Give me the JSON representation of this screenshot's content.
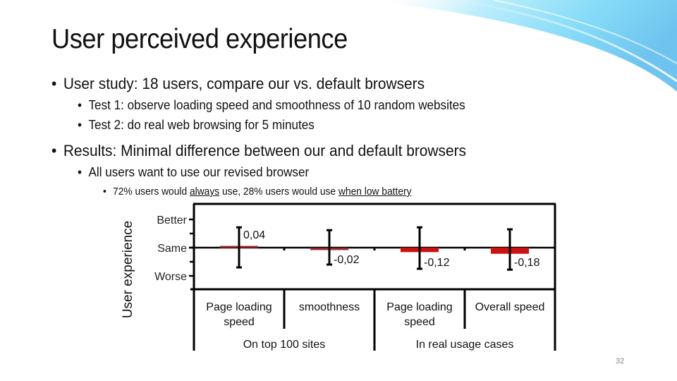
{
  "slide": {
    "title": "User perceived experience",
    "page_number": "32",
    "bullets": {
      "b1": "User study: 18 users, compare our vs. default browsers",
      "b1_sub1": "Test 1: observe loading speed and smoothness of 10 random websites",
      "b1_sub2": "Test 2: do real web browsing for 5 minutes",
      "b2": "Results: Minimal difference between our and default browsers",
      "b2_sub1": "All users want to use our revised browser",
      "b2_sub1_sub": {
        "part1": "72% users would ",
        "always": "always",
        "part2": " use, 28% users would use ",
        "when_low": "when low battery"
      }
    },
    "colors": {
      "bar": "#cc1111",
      "bar_faint": "#8b1a1a",
      "swoosh": "#7fd3f5"
    }
  },
  "chart_data": {
    "type": "bar",
    "title": "",
    "ylabel": "User experience",
    "xlabel": "",
    "y_tick_labels": [
      "Better",
      "Same",
      "Worse"
    ],
    "y_tick_values": [
      1,
      0,
      -1
    ],
    "ylim": [
      -1.5,
      1.5
    ],
    "grid": false,
    "categories": [
      "Page loading speed",
      "smoothness",
      "Page loading speed",
      "Overall speed"
    ],
    "category_lines": [
      [
        "Page loading",
        "speed"
      ],
      [
        "smoothness"
      ],
      [
        "Page loading",
        "speed"
      ],
      [
        "Overall speed"
      ]
    ],
    "groups": [
      {
        "label": "On top 100 sites",
        "categories": [
          0,
          1
        ]
      },
      {
        "label": "In real usage cases",
        "categories": [
          2,
          3
        ]
      }
    ],
    "values": [
      0.04,
      -0.02,
      -0.12,
      -0.18
    ],
    "value_labels": [
      "0,04",
      "-0,02",
      "-0,12",
      "-0,18"
    ],
    "error_low": [
      -0.7,
      -0.6,
      -0.75,
      -0.78
    ],
    "error_high": [
      0.72,
      0.62,
      0.72,
      0.65
    ]
  }
}
